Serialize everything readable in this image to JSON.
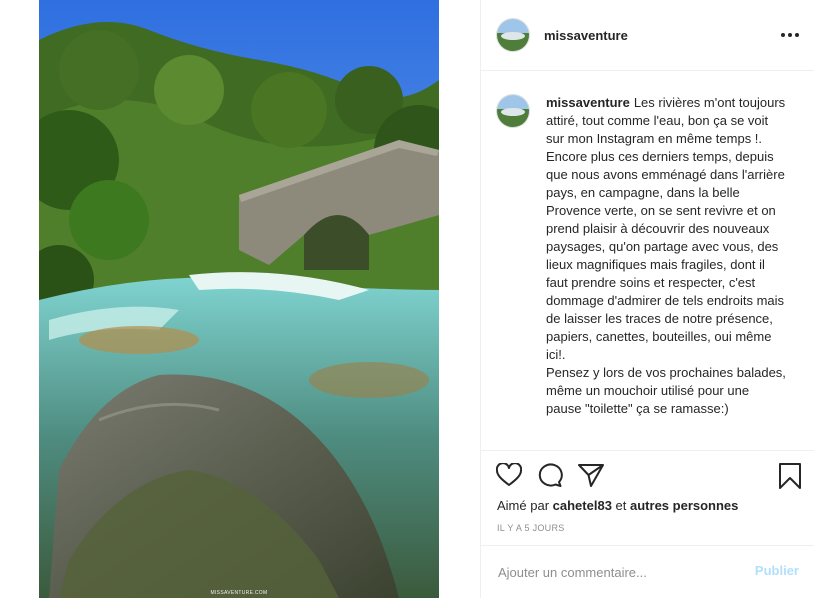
{
  "post": {
    "photo_alt": "River with stone bridge in Provence",
    "photo_credit": "MISSAVENTURE.COM"
  },
  "header": {
    "username": "missaventure",
    "more_icon": "more-horizontal-icon"
  },
  "caption": {
    "username": "missaventure",
    "text": "Les rivières m'ont toujours attiré, tout comme l'eau, bon ça se voit sur mon Instagram en même temps !. Encore plus ces derniers temps, depuis que nous avons emménagé dans l'arrière pays, en campagne, dans la belle Provence verte, on se sent revivre et on prend plaisir à découvrir des nouveaux paysages, qu'on partage avec vous, des lieux magnifiques mais fragiles, dont il faut prendre soins et respecter, c'est dommage d'admirer de tels endroits mais de laisser les traces de notre présence, papiers, canettes, bouteilles, oui même ici!.\nPensez y lors de vos prochaines balades, même un mouchoir utilisé pour une pause \"toilette\" ça se ramasse:)"
  },
  "actions": {
    "icons": [
      "heart-icon",
      "comment-icon",
      "share-icon",
      "bookmark-icon"
    ],
    "likes_prefix": "Aimé par",
    "liked_by_user": "cahetel83",
    "likes_joiner": "et",
    "likes_others": "autres personnes",
    "timestamp": "IL Y A 5 JOURS"
  },
  "comment": {
    "placeholder": "Ajouter un commentaire...",
    "publish_label": "Publier"
  },
  "colors": {
    "text": "#262626",
    "muted": "#8e8e8e",
    "border": "#efefef",
    "publish_disabled": "#b2dffc"
  }
}
